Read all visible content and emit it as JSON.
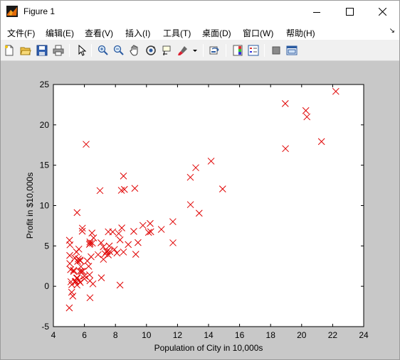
{
  "window": {
    "title": "Figure 1"
  },
  "menu": {
    "items": [
      "文件(F)",
      "编辑(E)",
      "查看(V)",
      "插入(I)",
      "工具(T)",
      "桌面(D)",
      "窗口(W)",
      "帮助(H)"
    ]
  },
  "toolbar": {
    "icons": [
      "new-figure-icon",
      "open-file-icon",
      "save-icon",
      "print-icon",
      "pointer-icon",
      "zoom-in-icon",
      "zoom-out-icon",
      "pan-hand-icon",
      "rotate-3d-icon",
      "data-cursor-icon",
      "brush-icon",
      "link-plot-icon",
      "colorbar-icon",
      "legend-icon",
      "hide-plot-tools-icon",
      "show-plot-tools-icon"
    ]
  },
  "colors": {
    "marker": "#e00000",
    "figure_bg": "#c8c8c8",
    "axes_bg": "#ffffff"
  },
  "chart_data": {
    "type": "scatter",
    "marker": "x",
    "title": "",
    "xlabel": "Population of City in 10,000s",
    "ylabel": "Profit in $10,000s",
    "xlim": [
      4,
      24
    ],
    "ylim": [
      -5,
      25
    ],
    "xticks": [
      4,
      6,
      8,
      10,
      12,
      14,
      16,
      18,
      20,
      22,
      24
    ],
    "yticks": [
      -5,
      0,
      5,
      10,
      15,
      20,
      25
    ],
    "grid": false,
    "x": [
      6.1101,
      5.5277,
      8.5186,
      7.0032,
      5.8598,
      8.3829,
      7.4764,
      8.5781,
      6.4862,
      5.0546,
      5.7107,
      14.164,
      5.734,
      8.4084,
      5.6407,
      5.3794,
      6.3654,
      5.1301,
      6.4296,
      7.0708,
      6.1891,
      20.27,
      5.4901,
      6.3261,
      5.5649,
      18.945,
      12.828,
      10.957,
      13.176,
      22.203,
      5.2524,
      6.5894,
      9.2482,
      5.8918,
      8.2111,
      7.9334,
      8.0959,
      5.6063,
      12.836,
      6.3534,
      5.4069,
      6.8825,
      11.708,
      5.7737,
      7.8247,
      7.0931,
      5.0702,
      5.8014,
      11.7,
      5.5416,
      7.5402,
      5.3077,
      7.4239,
      7.6031,
      6.3328,
      6.3589,
      6.2742,
      5.6397,
      9.3102,
      9.4536,
      8.8254,
      5.1793,
      21.279,
      14.908,
      18.959,
      7.2182,
      8.2951,
      10.236,
      5.4994,
      20.341,
      10.136,
      7.3345,
      6.0062,
      7.2259,
      5.0269,
      6.5479,
      7.5386,
      5.0365,
      10.274,
      5.1077,
      5.7292,
      5.1884,
      6.3557,
      9.7687,
      6.5159,
      8.5172,
      9.1802,
      6.002,
      5.5204,
      5.0594,
      5.7077,
      7.6366,
      5.8707,
      5.3054,
      8.2934,
      13.394,
      5.4369
    ],
    "y": [
      17.592,
      9.1302,
      13.662,
      11.854,
      6.8233,
      11.886,
      4.3483,
      12.0,
      6.5987,
      3.8166,
      3.2522,
      15.505,
      3.1551,
      7.2258,
      0.71618,
      3.5129,
      5.3048,
      0.56077,
      3.6518,
      5.3893,
      3.1386,
      21.767,
      4.263,
      5.1875,
      3.0825,
      22.638,
      13.501,
      7.0467,
      14.692,
      24.147,
      -1.22,
      5.9966,
      12.134,
      1.8495,
      6.5426,
      4.5623,
      4.1164,
      3.3928,
      10.117,
      5.4974,
      0.55657,
      3.9115,
      5.3854,
      2.4406,
      6.7318,
      1.0463,
      5.1337,
      1.844,
      8.0043,
      1.0179,
      6.7504,
      1.8396,
      4.2885,
      4.9981,
      1.4233,
      -1.4211,
      2.4756,
      4.6042,
      3.9624,
      5.4141,
      5.1694,
      -0.74279,
      17.929,
      12.054,
      17.054,
      4.8852,
      5.7442,
      7.7754,
      1.0173,
      20.992,
      6.6799,
      4.0259,
      1.2784,
      3.3411,
      -2.6807,
      0.29678,
      3.8845,
      5.7014,
      6.7526,
      2.0576,
      0.47953,
      0.20421,
      0.67861,
      7.5435,
      5.3436,
      4.2415,
      6.7981,
      0.92695,
      0.152,
      2.8214,
      1.8451,
      4.2959,
      7.2029,
      1.9869,
      0.14454,
      9.0551,
      0.61705
    ]
  }
}
